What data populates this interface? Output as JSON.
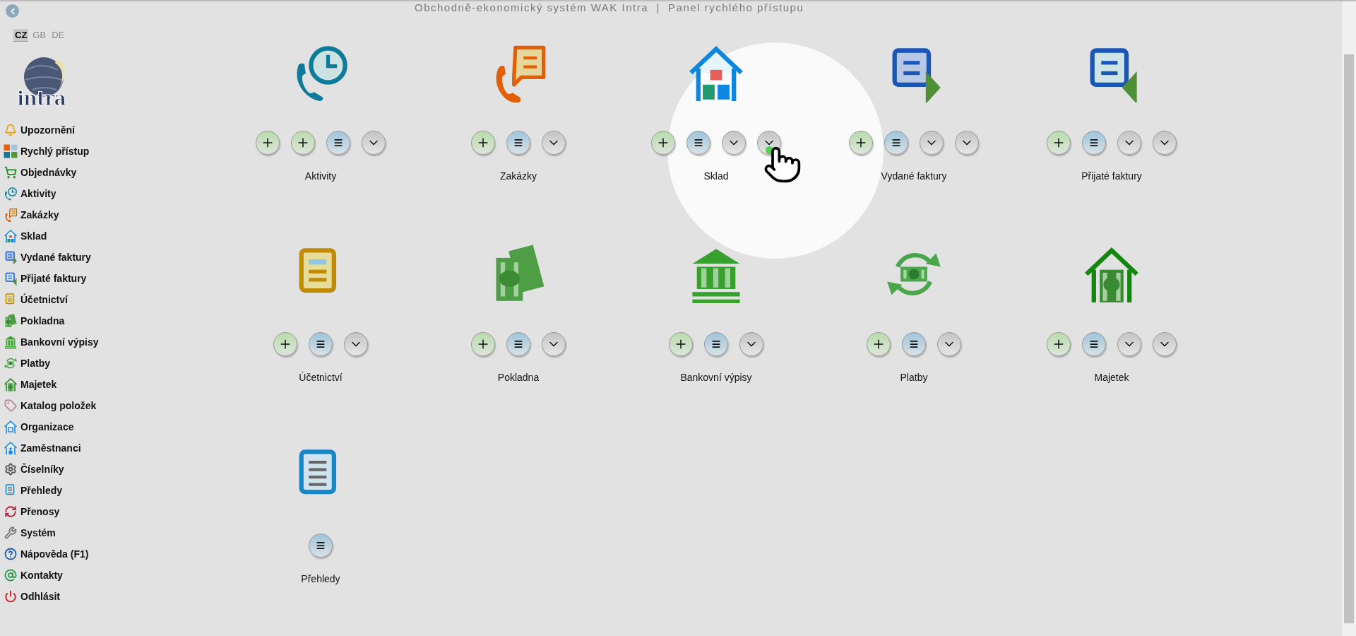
{
  "title": "Obchodně-ekonomický systém WAK Intra  |  Panel rychlého přístupu",
  "languages": [
    {
      "label": "CZ",
      "selected": true
    },
    {
      "label": "GB",
      "selected": false
    },
    {
      "label": "DE",
      "selected": false
    }
  ],
  "logo": {
    "text": "intra"
  },
  "sidebar": {
    "items": [
      {
        "label": "Upozornění",
        "kind": "bell"
      },
      {
        "label": "Rychlý přístup",
        "kind": "quick"
      },
      {
        "label": "Objednávky",
        "kind": "cart"
      },
      {
        "label": "Aktivity",
        "kind": "activities"
      },
      {
        "label": "Zakázky",
        "kind": "orders"
      },
      {
        "label": "Sklad",
        "kind": "warehouse"
      },
      {
        "label": "Vydané faktury",
        "kind": "issued"
      },
      {
        "label": "Přijaté faktury",
        "kind": "received"
      },
      {
        "label": "Účetnictví",
        "kind": "accounting"
      },
      {
        "label": "Pokladna",
        "kind": "cash"
      },
      {
        "label": "Bankovní výpisy",
        "kind": "bank"
      },
      {
        "label": "Platby",
        "kind": "payments"
      },
      {
        "label": "Majetek",
        "kind": "assets"
      },
      {
        "label": "Katalog položek",
        "kind": "tag"
      },
      {
        "label": "Organizace",
        "kind": "organization"
      },
      {
        "label": "Zaměstnanci",
        "kind": "employees"
      },
      {
        "label": "Číselníky",
        "kind": "gear"
      },
      {
        "label": "Přehledy",
        "kind": "reports"
      },
      {
        "label": "Přenosy",
        "kind": "transfers"
      },
      {
        "label": "Systém",
        "kind": "wrench"
      },
      {
        "label": "Nápověda (F1)",
        "kind": "help"
      },
      {
        "label": "Kontakty",
        "kind": "contacts"
      },
      {
        "label": "Odhlásit",
        "kind": "logout"
      }
    ]
  },
  "tiles": [
    {
      "label": "Aktivity",
      "kind": "activities",
      "buttons": [
        {
          "kind": "add"
        },
        {
          "kind": "add"
        },
        {
          "kind": "list"
        },
        {
          "kind": "dropdown"
        }
      ]
    },
    {
      "label": "Zakázky",
      "kind": "orders",
      "buttons": [
        {
          "kind": "add"
        },
        {
          "kind": "list"
        },
        {
          "kind": "dropdown"
        }
      ]
    },
    {
      "label": "Sklad",
      "kind": "warehouse",
      "buttons": [
        {
          "kind": "add"
        },
        {
          "kind": "list"
        },
        {
          "kind": "dropdown"
        },
        {
          "kind": "dropdown"
        }
      ]
    },
    {
      "label": "Vydané faktury",
      "kind": "issued",
      "buttons": [
        {
          "kind": "add"
        },
        {
          "kind": "list"
        },
        {
          "kind": "dropdown"
        },
        {
          "kind": "dropdown"
        }
      ]
    },
    {
      "label": "Přijaté faktury",
      "kind": "received",
      "buttons": [
        {
          "kind": "add"
        },
        {
          "kind": "list"
        },
        {
          "kind": "dropdown"
        },
        {
          "kind": "dropdown"
        }
      ]
    },
    {
      "label": "Účetnictví",
      "kind": "accounting",
      "buttons": [
        {
          "kind": "add"
        },
        {
          "kind": "list"
        },
        {
          "kind": "dropdown"
        }
      ]
    },
    {
      "label": "Pokladna",
      "kind": "cash",
      "buttons": [
        {
          "kind": "add"
        },
        {
          "kind": "list"
        },
        {
          "kind": "dropdown"
        }
      ]
    },
    {
      "label": "Bankovní výpisy",
      "kind": "bank",
      "buttons": [
        {
          "kind": "add"
        },
        {
          "kind": "list"
        },
        {
          "kind": "dropdown"
        }
      ]
    },
    {
      "label": "Platby",
      "kind": "payments",
      "buttons": [
        {
          "kind": "add"
        },
        {
          "kind": "list"
        },
        {
          "kind": "dropdown"
        }
      ]
    },
    {
      "label": "Majetek",
      "kind": "assets",
      "buttons": [
        {
          "kind": "add"
        },
        {
          "kind": "list"
        },
        {
          "kind": "dropdown"
        },
        {
          "kind": "dropdown"
        }
      ]
    },
    {
      "label": "Přehledy",
      "kind": "reports",
      "buttons": [
        {
          "kind": "list"
        }
      ]
    }
  ]
}
